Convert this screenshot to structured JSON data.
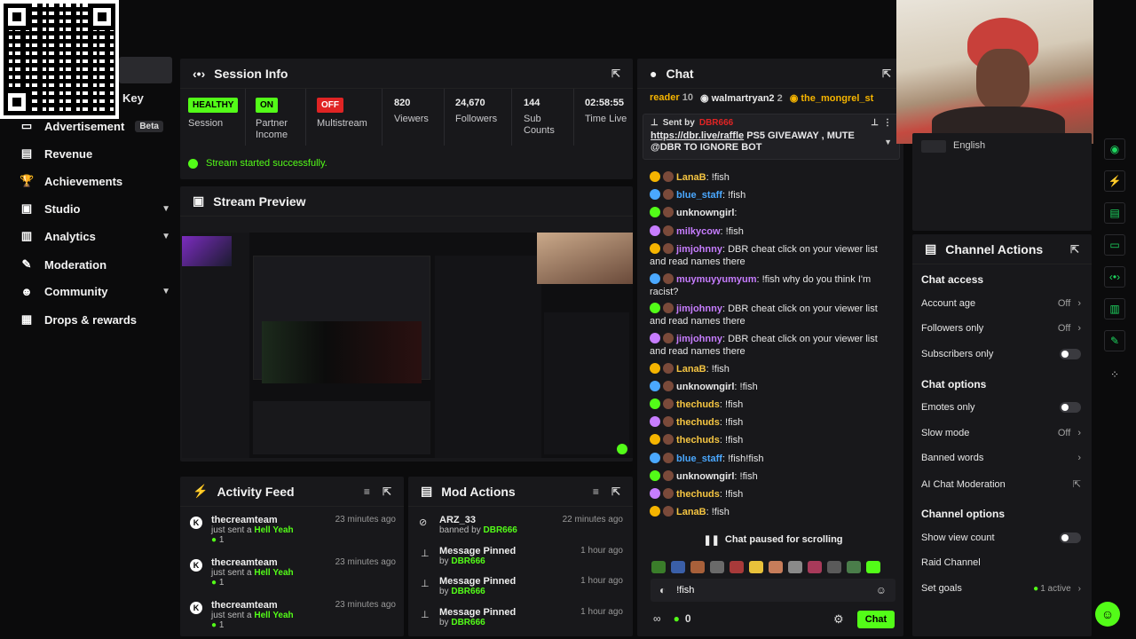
{
  "sidebar": {
    "partial_item": "Key",
    "items": [
      {
        "label": "Advertisement",
        "badge": "Beta",
        "icon": "ad-icon"
      },
      {
        "label": "Revenue",
        "icon": "dollar-icon"
      },
      {
        "label": "Achievements",
        "icon": "trophy-icon"
      },
      {
        "label": "Studio",
        "icon": "video-icon",
        "expandable": true
      },
      {
        "label": "Analytics",
        "icon": "chart-icon",
        "expandable": true
      },
      {
        "label": "Moderation",
        "icon": "wrench-icon"
      },
      {
        "label": "Community",
        "icon": "people-icon",
        "expandable": true
      },
      {
        "label": "Drops & rewards",
        "icon": "gift-icon"
      }
    ]
  },
  "session": {
    "title": "Session Info",
    "stats": [
      {
        "pill": "HEALTHY",
        "label": "Session"
      },
      {
        "pill": "ON",
        "label": "Partner Income"
      },
      {
        "pill": "OFF",
        "label": "Multistream"
      },
      {
        "value": "820",
        "label": "Viewers"
      },
      {
        "value": "24,670",
        "label": "Followers"
      },
      {
        "value": "144",
        "label": "Sub Counts"
      },
      {
        "value": "02:58:55",
        "label": "Time Live"
      }
    ],
    "status": "Stream started successfully."
  },
  "preview": {
    "title": "Stream Preview"
  },
  "activity": {
    "title": "Activity Feed",
    "items": [
      {
        "name": "thecreamteam",
        "action": "just sent a",
        "gift": "Hell Yeah",
        "count": "1",
        "time": "23 minutes ago"
      },
      {
        "name": "thecreamteam",
        "action": "just sent a",
        "gift": "Hell Yeah",
        "count": "1",
        "time": "23 minutes ago"
      },
      {
        "name": "thecreamteam",
        "action": "just sent a",
        "gift": "Hell Yeah",
        "count": "1",
        "time": "23 minutes ago"
      }
    ]
  },
  "mod": {
    "title": "Mod Actions",
    "items": [
      {
        "title": "ARZ_33",
        "by_prefix": "banned by",
        "by": "DBR666",
        "time": "22 minutes ago"
      },
      {
        "title": "Message Pinned",
        "by_prefix": "by",
        "by": "DBR666",
        "time": "1 hour ago"
      },
      {
        "title": "Message Pinned",
        "by_prefix": "by",
        "by": "DBR666",
        "time": "1 hour ago"
      },
      {
        "title": "Message Pinned",
        "by_prefix": "by",
        "by": "DBR666",
        "time": "1 hour ago"
      }
    ]
  },
  "chat": {
    "title": "Chat",
    "top_users": [
      {
        "name": "reader",
        "count": "10"
      },
      {
        "name": "walmartryan2",
        "count": "2"
      },
      {
        "name": "the_mongrel_st",
        "count": ""
      }
    ],
    "pinned": {
      "sent_by_label": "Sent by",
      "sender": "DBR666",
      "link": "https://dbr.live/raffle",
      "text": "PS5 GIVEAWAY , MUTE @DBR TO IGNORE BOT"
    },
    "messages": [
      {
        "user": "LanaB",
        "color": "#f5c542",
        "text": "!fish"
      },
      {
        "user": "blue_staff",
        "color": "#4aa8ff",
        "text": "!fish"
      },
      {
        "user": "unknowngirl",
        "color": "#e8e8e8",
        "text": ""
      },
      {
        "user": "milkycow",
        "color": "#c77dff",
        "text": "!fish"
      },
      {
        "user": "jimjohnny",
        "color": "#c77dff",
        "text": "DBR cheat click on your viewer list and read names there"
      },
      {
        "user": "muymuyyumyum",
        "color": "#c77dff",
        "text": "!fish why do you think I'm racist?"
      },
      {
        "user": "jimjohnny",
        "color": "#c77dff",
        "text": "DBR cheat click on your viewer list and read names there"
      },
      {
        "user": "jimjohnny",
        "color": "#c77dff",
        "text": "DBR cheat click on your viewer list and read names there"
      },
      {
        "user": "LanaB",
        "color": "#f5c542",
        "text": "!fish"
      },
      {
        "user": "unknowngirl",
        "color": "#e8e8e8",
        "text": "!fish"
      },
      {
        "user": "thechuds",
        "color": "#f5c542",
        "text": "!fish"
      },
      {
        "user": "thechuds",
        "color": "#f5c542",
        "text": "!fish"
      },
      {
        "user": "thechuds",
        "color": "#f5c542",
        "text": "!fish"
      },
      {
        "user": "blue_staff",
        "color": "#4aa8ff",
        "text": "!fish!fish"
      },
      {
        "user": "unknowngirl",
        "color": "#e8e8e8",
        "text": "!fish"
      },
      {
        "user": "thechuds",
        "color": "#f5c542",
        "text": "!fish"
      },
      {
        "user": "LanaB",
        "color": "#f5c542",
        "text": "!fish"
      }
    ],
    "paused": "Chat paused for scrolling",
    "input_value": "!fish",
    "points": "0",
    "send_label": "Chat"
  },
  "channel_actions": {
    "title": "Channel Actions",
    "language": "English",
    "groups": [
      {
        "heading": "Chat access",
        "rows": [
          {
            "label": "Account age",
            "value": "Off",
            "kind": "chevron"
          },
          {
            "label": "Followers only",
            "value": "Off",
            "kind": "chevron"
          },
          {
            "label": "Subscribers only",
            "value": "",
            "kind": "toggle"
          }
        ]
      },
      {
        "heading": "Chat options",
        "rows": [
          {
            "label": "Emotes only",
            "value": "",
            "kind": "toggle"
          },
          {
            "label": "Slow mode",
            "value": "Off",
            "kind": "chevron"
          },
          {
            "label": "Banned words",
            "value": "",
            "kind": "chevron"
          },
          {
            "label": "AI Chat Moderation",
            "value": "",
            "kind": "external"
          }
        ]
      },
      {
        "heading": "Channel options",
        "rows": [
          {
            "label": "Show view count",
            "value": "",
            "kind": "toggle"
          },
          {
            "label": "Raid Channel",
            "value": "",
            "kind": "none"
          },
          {
            "label": "Set goals",
            "value": "1 active",
            "kind": "chevron"
          }
        ]
      }
    ]
  },
  "colors": {
    "accent": "#53fc18",
    "panel": "#18181b",
    "bg": "#0b0b0c"
  }
}
